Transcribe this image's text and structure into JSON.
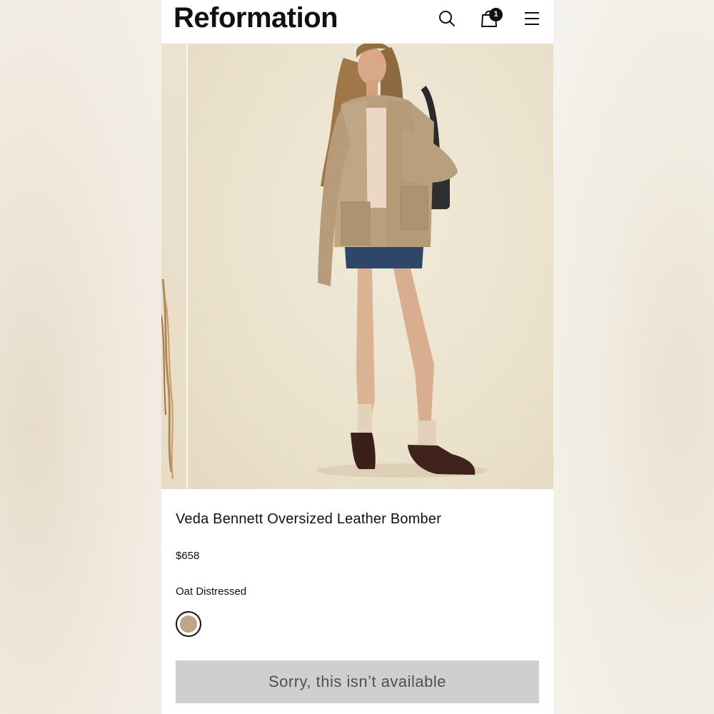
{
  "header": {
    "logo": "Reformation",
    "bag_count": "1",
    "icons": [
      "search-icon",
      "shopping-bag-icon",
      "hamburger-menu-icon"
    ]
  },
  "product": {
    "title": "Veda Bennett Oversized Leather Bomber",
    "price": "$658",
    "color_name": "Oat Distressed",
    "swatch_color": "#bca686",
    "availability_button": "Sorry, this isn’t available"
  },
  "colors": {
    "accent": "#111111",
    "disabled_button_bg": "#cfcfcf",
    "disabled_button_text": "#505050"
  }
}
